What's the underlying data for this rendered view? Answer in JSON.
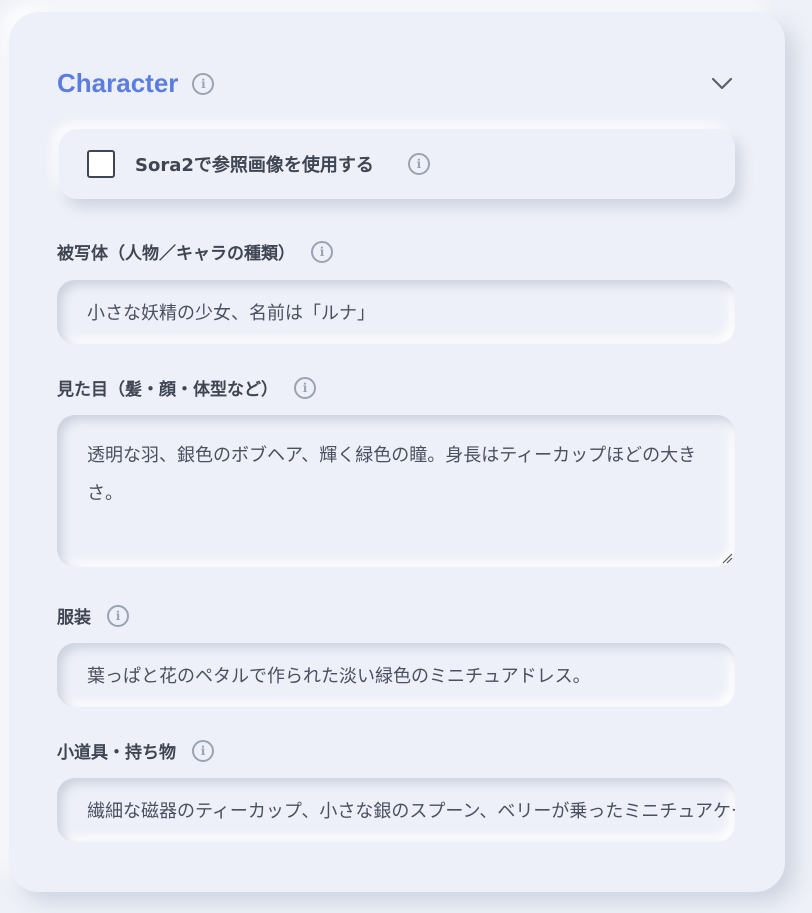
{
  "section": {
    "title": "Character",
    "chevron_icon": "chevron-down-icon",
    "info_icon": "info-icon"
  },
  "reference_image": {
    "label": "Sora2で参照画像を使用する",
    "checked": false
  },
  "fields": {
    "subject": {
      "label": "被写体（人物／キャラの種類）",
      "value": "小さな妖精の少女、名前は「ルナ」"
    },
    "appearance": {
      "label": "見た目（髪・顔・体型など）",
      "value": "透明な羽、銀色のボブヘア、輝く緑色の瞳。身長はティーカップほどの大きさ。"
    },
    "outfit": {
      "label": "服装",
      "value": "葉っぱと花のペタルで作られた淡い緑色のミニチュアドレス。"
    },
    "props": {
      "label": "小道具・持ち物",
      "value": "繊細な磁器のティーカップ、小さな銀のスプーン、ベリーが乗ったミニチュアケーキ"
    }
  },
  "colors": {
    "accent": "#5b7de0",
    "text": "#3f4552",
    "background": "#edf0f8"
  }
}
